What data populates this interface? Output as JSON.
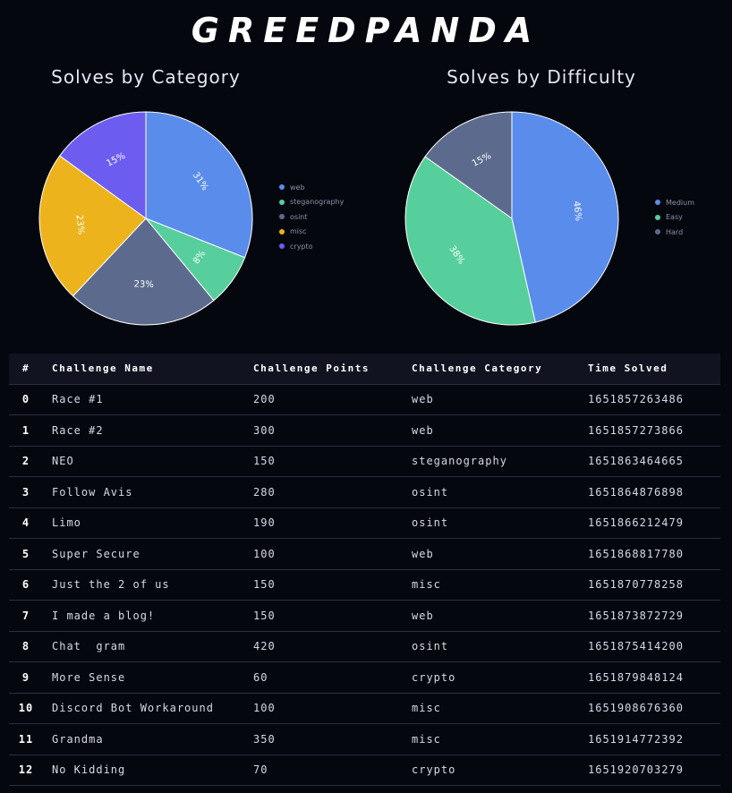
{
  "brand": "GREEDPANDA",
  "charts": {
    "category_title": "Solves by Category",
    "difficulty_title": "Solves by Difficulty"
  },
  "chart_data": [
    {
      "type": "pie",
      "title": "Solves by Category",
      "legend_position": "right",
      "slices": [
        {
          "label": "web",
          "value": 31,
          "color": "#5a8ceb"
        },
        {
          "label": "steganography",
          "value": 8,
          "color": "#56cf9c"
        },
        {
          "label": "osint",
          "value": 23,
          "color": "#5c6b8d"
        },
        {
          "label": "misc",
          "value": 23,
          "color": "#ecb31c"
        },
        {
          "label": "crypto",
          "value": 15,
          "color": "#6c5df0"
        }
      ]
    },
    {
      "type": "pie",
      "title": "Solves by Difficulty",
      "legend_position": "right",
      "slices": [
        {
          "label": "Medium",
          "value": 46,
          "color": "#5a8ceb"
        },
        {
          "label": "Easy",
          "value": 38,
          "color": "#56cf9c"
        },
        {
          "label": "Hard",
          "value": 15,
          "color": "#5c6b8d"
        }
      ]
    }
  ],
  "table": {
    "headers": [
      "#",
      "Challenge Name",
      "Challenge Points",
      "Challenge Category",
      "Time Solved"
    ],
    "rows": [
      [
        "0",
        "Race #1",
        "200",
        "web",
        "1651857263486"
      ],
      [
        "1",
        "Race #2",
        "300",
        "web",
        "1651857273866"
      ],
      [
        "2",
        "NEO",
        "150",
        "steganography",
        "1651863464665"
      ],
      [
        "3",
        "Follow Avis",
        "280",
        "osint",
        "1651864876898"
      ],
      [
        "4",
        "Limo",
        "190",
        "osint",
        "1651866212479"
      ],
      [
        "5",
        "Super Secure",
        "100",
        "web",
        "1651868817780"
      ],
      [
        "6",
        "Just the 2 of us",
        "150",
        "misc",
        "1651870778258"
      ],
      [
        "7",
        "I made a blog!",
        "150",
        "web",
        "1651873872729"
      ],
      [
        "8",
        "Chat  gram",
        "420",
        "osint",
        "1651875414200"
      ],
      [
        "9",
        "More Sense",
        "60",
        "crypto",
        "1651879848124"
      ],
      [
        "10",
        "Discord Bot Workaround",
        "100",
        "misc",
        "1651908676360"
      ],
      [
        "11",
        "Grandma",
        "350",
        "misc",
        "1651914772392"
      ],
      [
        "12",
        "No Kidding",
        "70",
        "crypto",
        "1651920703279"
      ]
    ]
  }
}
